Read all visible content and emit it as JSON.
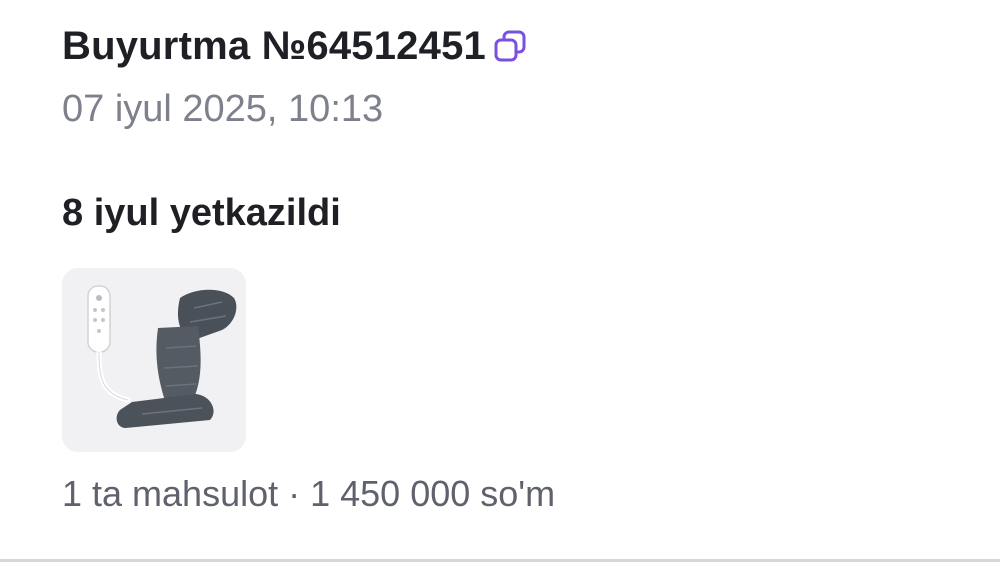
{
  "order": {
    "title": "Buyurtma №64512451",
    "date": "07 iyul 2025, 10:13",
    "copy_icon": "copy-icon",
    "accent_color": "#7b4fe0"
  },
  "delivery": {
    "status": "8 iyul yetkazildi"
  },
  "product": {
    "image_icon": "leg-massager-image"
  },
  "summary": {
    "text": "1 ta mahsulot · 1 450 000 so'm"
  }
}
